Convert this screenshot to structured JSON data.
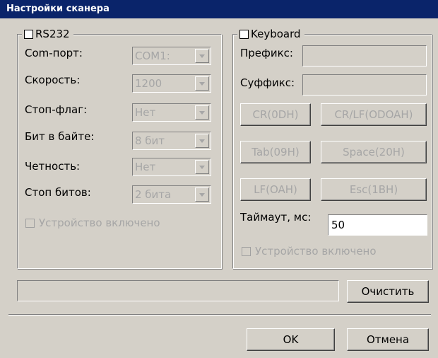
{
  "window": {
    "title": "Настройки сканера"
  },
  "rs232": {
    "legend": "RS232",
    "fields": [
      {
        "label": "Com-порт:",
        "value": "COM1:"
      },
      {
        "label": "Скорость:",
        "value": "1200"
      },
      {
        "label": "Стоп-флаг:",
        "value": "Нет"
      },
      {
        "label": "Бит в байте:",
        "value": "8 бит"
      },
      {
        "label": "Четность:",
        "value": "Нет"
      },
      {
        "label": "Стоп битов:",
        "value": "2 бита"
      }
    ],
    "device_enabled": "Устройство включено"
  },
  "keyboard": {
    "legend": "Keyboard",
    "prefix_label": "Префикс:",
    "prefix_value": "",
    "suffix_label": "Суффикс:",
    "suffix_value": "",
    "buttons": [
      "CR(0DH)",
      "CR/LF(ODOAH)",
      "Tab(09H)",
      "Space(20H)",
      "LF(OAH)",
      "Esc(1BH)"
    ],
    "timeout_label": "Таймаут, мс:",
    "timeout_value": "50",
    "device_enabled": "Устройство включено"
  },
  "actions": {
    "clear": "Очистить",
    "ok": "OK",
    "cancel": "Отмена"
  },
  "colors": {
    "titlebar": "#0a246a",
    "face": "#d4d0c8",
    "disabled_text": "#a6a6a6"
  }
}
